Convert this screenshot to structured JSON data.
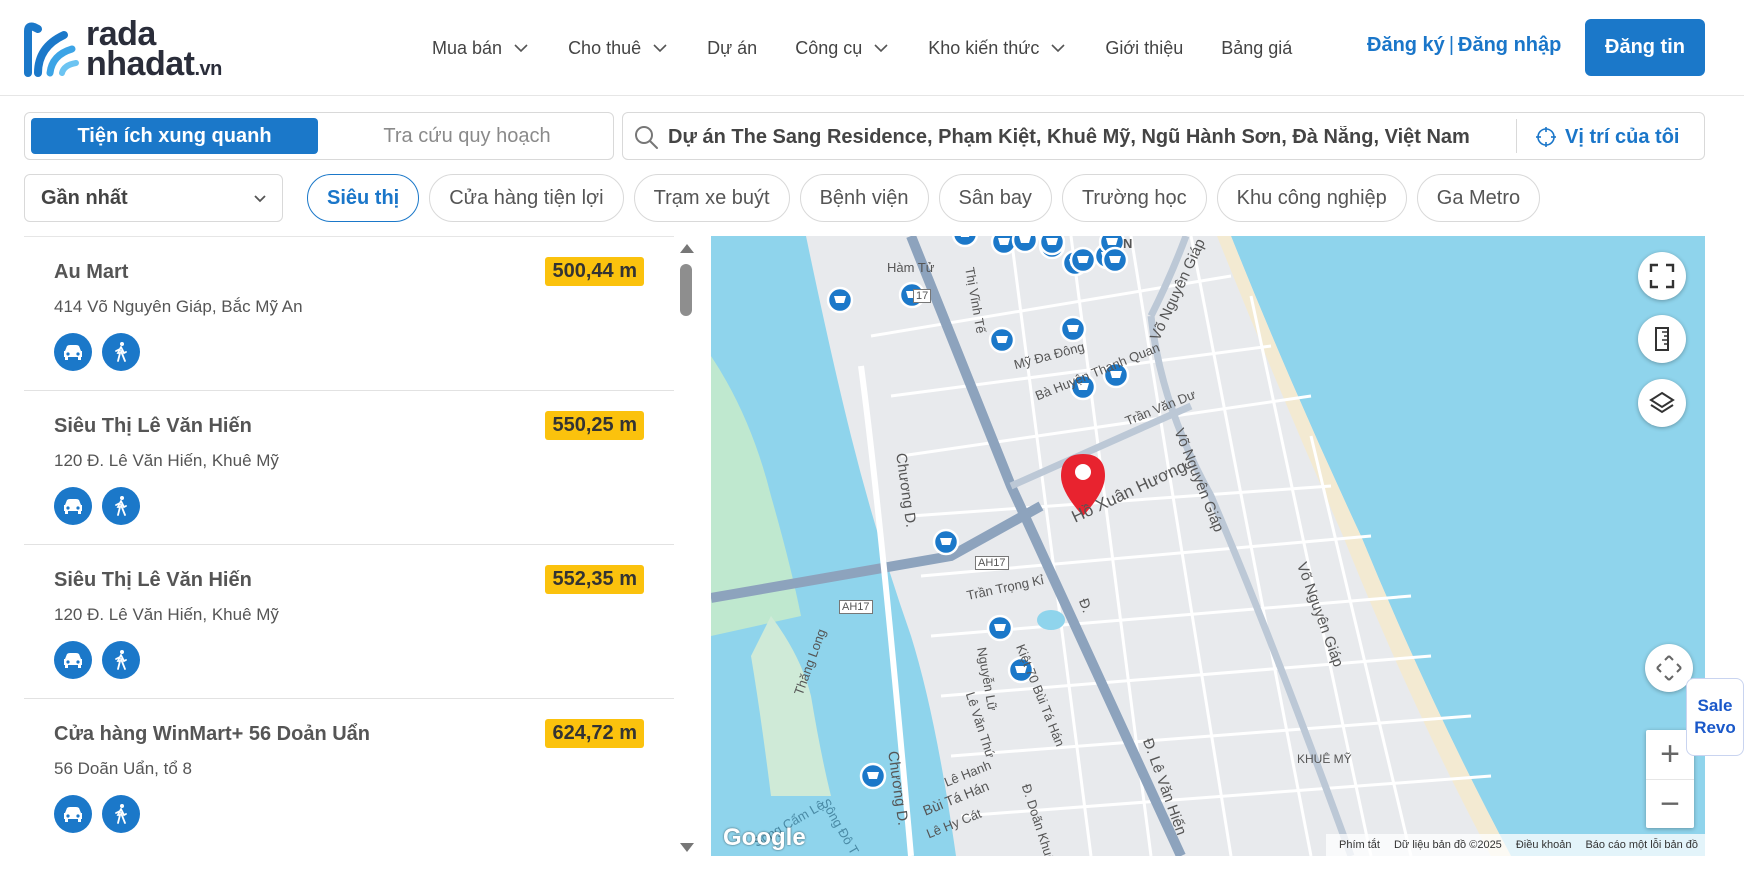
{
  "brand": {
    "name_top": "rada",
    "name_bottom": "nhadat",
    "tld": ".vn",
    "primary_color": "#1b78c9",
    "highlight_color": "#fbc20d"
  },
  "nav": {
    "items": [
      {
        "label": "Mua bán",
        "dropdown": true
      },
      {
        "label": "Cho thuê",
        "dropdown": true
      },
      {
        "label": "Dự án",
        "dropdown": false
      },
      {
        "label": "Công cụ",
        "dropdown": true
      },
      {
        "label": "Kho kiến thức",
        "dropdown": true
      },
      {
        "label": "Giới thiệu",
        "dropdown": false
      },
      {
        "label": "Bảng giá",
        "dropdown": false
      }
    ],
    "register": "Đăng ký",
    "separator": "|",
    "login": "Đăng nhập",
    "post": "Đăng tin"
  },
  "mode": {
    "active": "Tiện ích xung quanh",
    "inactive": "Tra cứu quy hoạch"
  },
  "search": {
    "value": "Dự án The Sang Residence, Phạm Kiệt, Khuê Mỹ, Ngũ Hành Sơn, Đà Nẵng, Việt Nam",
    "locate": "Vị trí của tôi"
  },
  "sort": {
    "selected": "Gần nhất"
  },
  "categories": [
    "Siêu thị",
    "Cửa hàng tiện lợi",
    "Trạm xe buýt",
    "Bệnh viện",
    "Sân bay",
    "Trường học",
    "Khu công nghiệp",
    "Ga Metro"
  ],
  "results": [
    {
      "name": "Au Mart",
      "address": "414 Võ Nguyên Giáp, Bắc Mỹ An",
      "distance": "500,44 m"
    },
    {
      "name": "Siêu Thị Lê Văn Hiến",
      "address": "120 Đ. Lê Văn Hiến, Khuê Mỹ",
      "distance": "550,25 m"
    },
    {
      "name": "Siêu Thị Lê Văn Hiến",
      "address": "120 Đ. Lê Văn Hiến, Khuê Mỹ",
      "distance": "552,35 m"
    },
    {
      "name": "Cửa hàng WinMart+ 56 Doản Uẩn",
      "address": "56 Doãn Uẩn, tổ 8",
      "distance": "624,72 m"
    }
  ],
  "map": {
    "labels": {
      "ham_tu": "Hàm Tử",
      "ah17": "AH17",
      "route17": "17",
      "thi_vinh_te": "Thị Vĩnh Tế",
      "my_da_dong": "Mỹ Đa Đông",
      "ba_huyen": "Bà Huyện Thanh Quan",
      "tran_van_du": "Trần Văn Dư",
      "vo_nguyen_giap": "Võ Nguyên Giáp",
      "ho_xuan_huong": "Hồ Xuân Hương",
      "chuong_d": "Chương D.",
      "tran_trong_kim": "Trần Trọng Kỉ",
      "thang_long": "Thăng Long",
      "nguyen_lu": "Nguyễn Lữ",
      "kiet70": "Kiệt 70 Bùi Tá Hán",
      "le_van_thu": "Lê Văn Thứ",
      "khue_my": "KHUÊ MỸ",
      "cam_le": "Sông Cẩm Lệ",
      "song_do": "Sông Đô T",
      "bui_ta_han": "Bùi Tá Hán",
      "le_hy_cat": "Lê Hy Cát",
      "le_van_hien": "Đ. Lê Văn Hiến",
      "doan_khue": "Đ. Doãn Khuê",
      "d": "Đ.",
      "le_thanh": "Lê Hanh",
      "n": "N"
    },
    "google": "Google",
    "attribution": {
      "shortcuts": "Phím tắt",
      "data": "Dữ liệu bản đồ ©2025",
      "terms": "Điều khoản",
      "report": "Báo cáo một lỗi bản đồ"
    },
    "water_color": "#8fd4ec",
    "road_color": "#8da3bd",
    "pin_color": "#e8232f"
  },
  "sale_revo": {
    "line1": "Sale",
    "line2": "Revo"
  }
}
